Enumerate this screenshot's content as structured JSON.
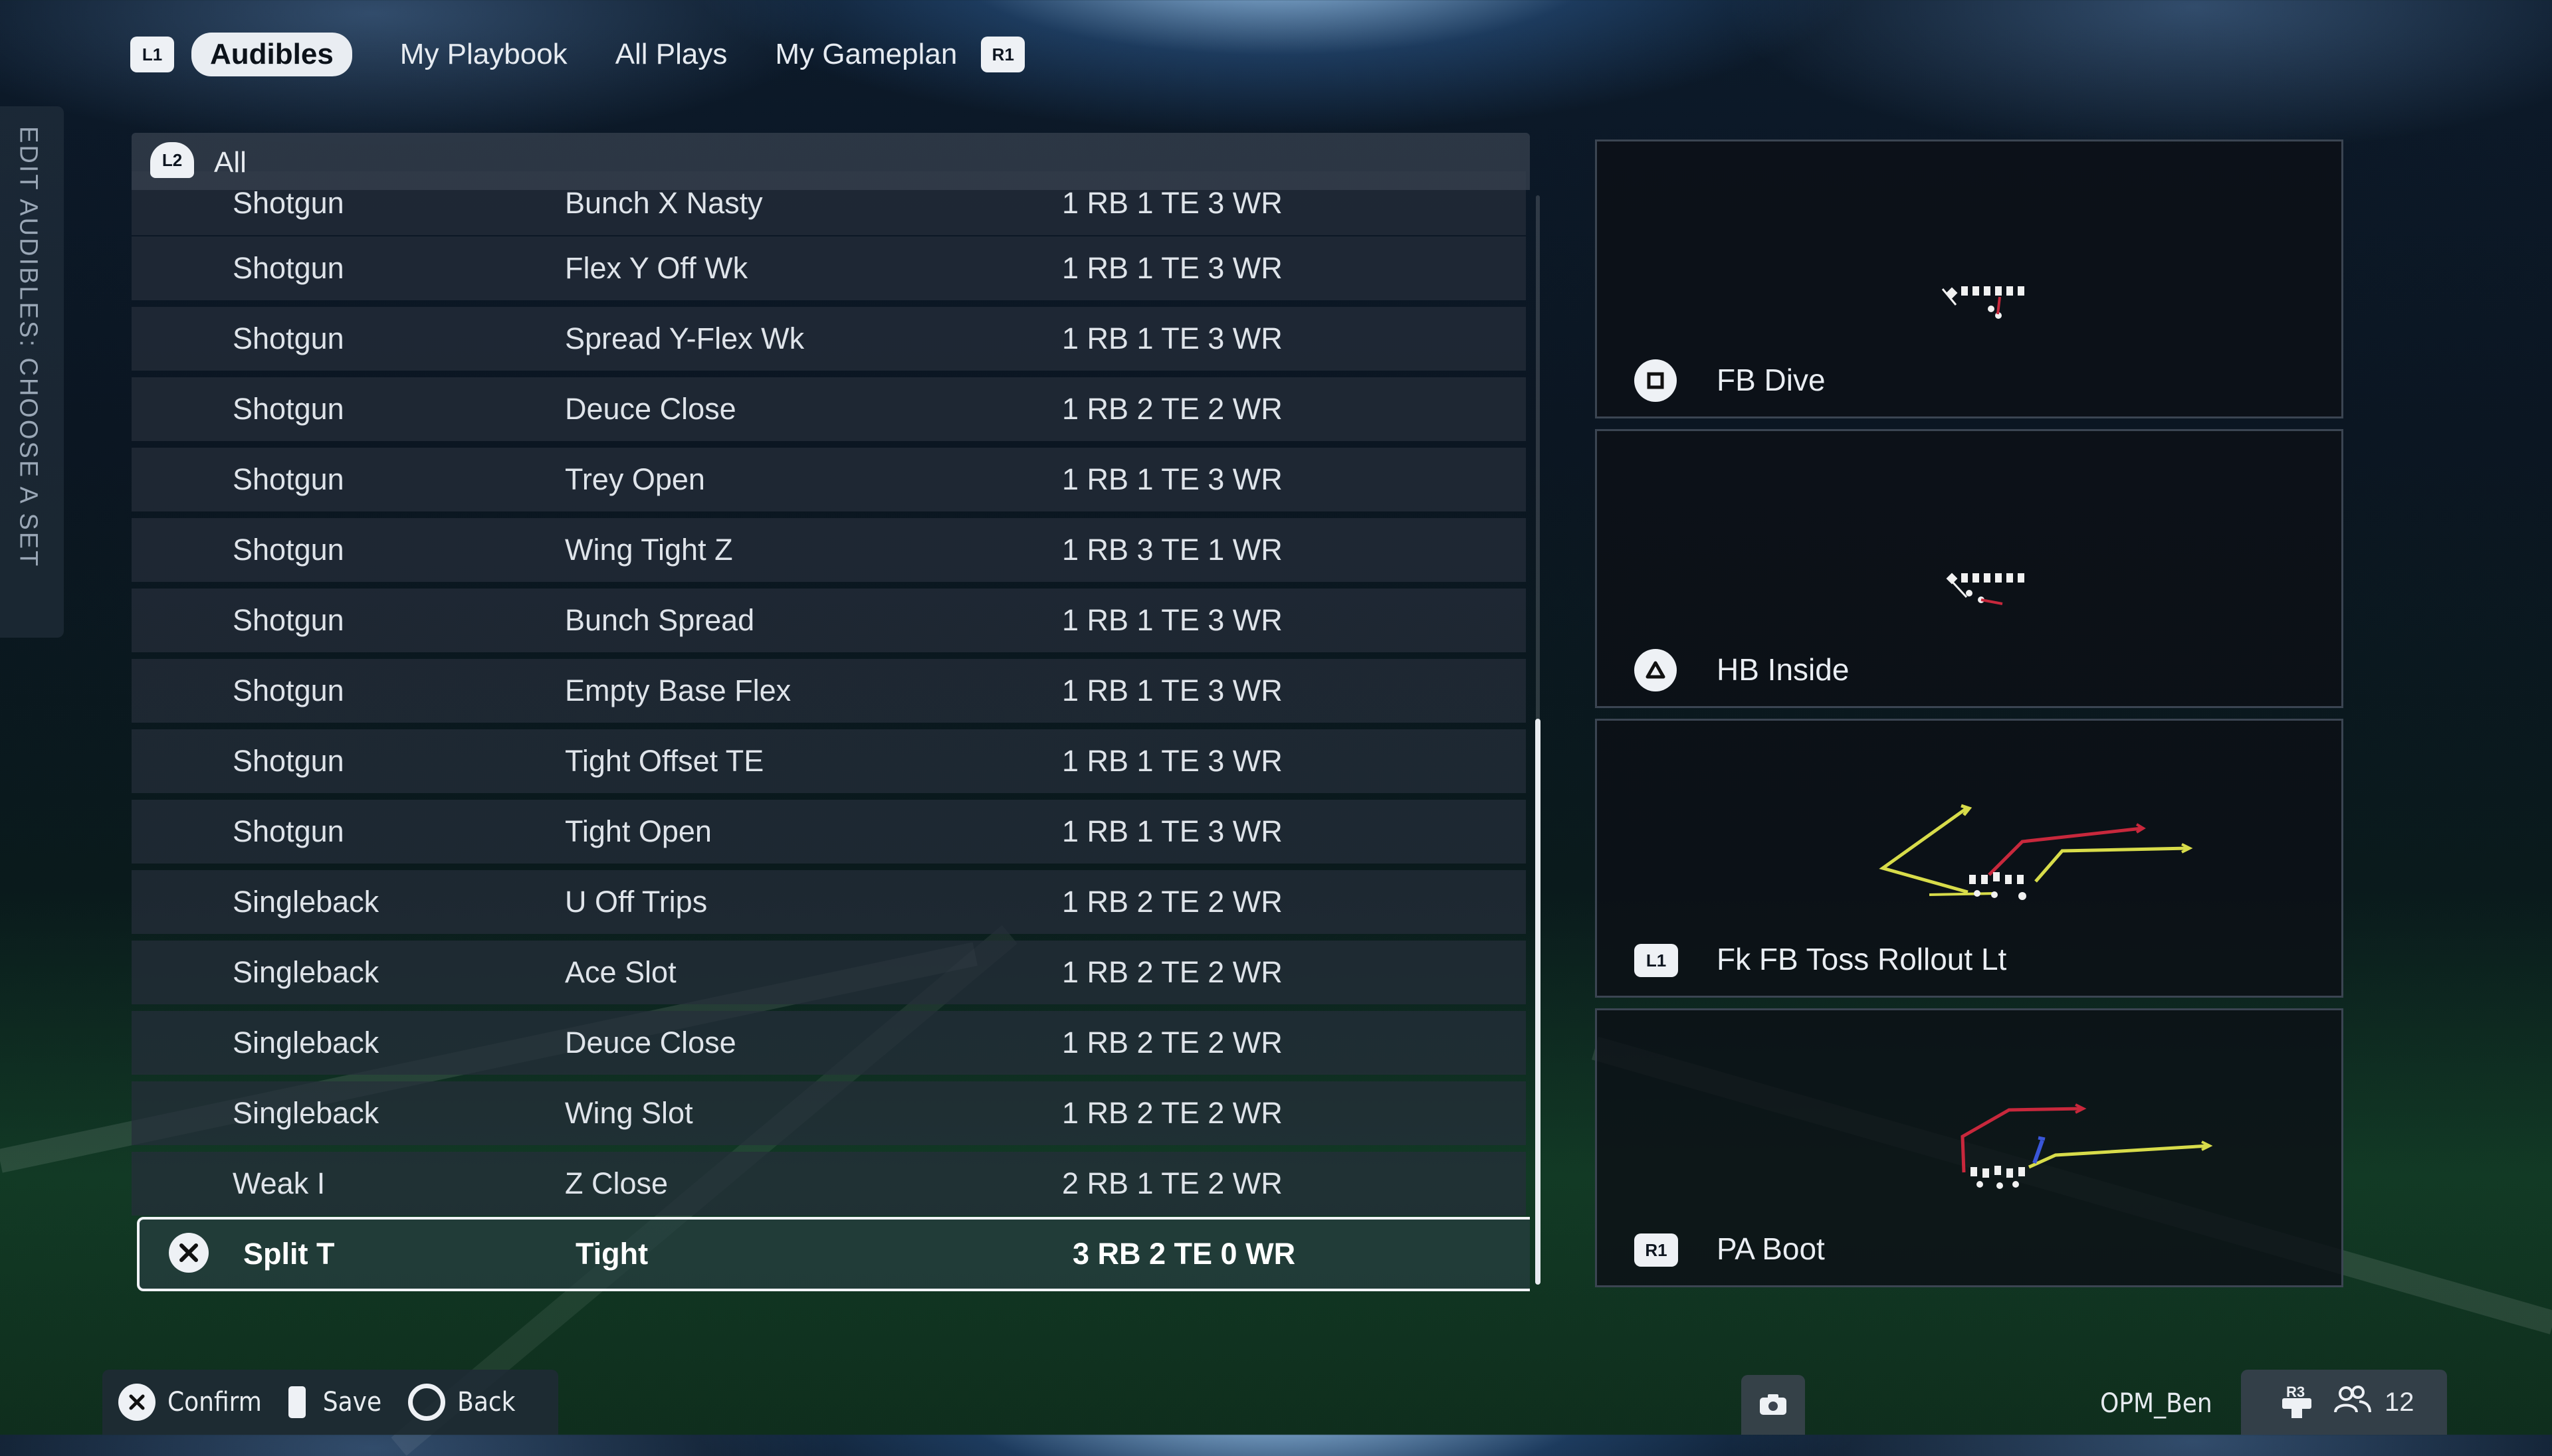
{
  "tabs": {
    "left_bumper": "L1",
    "right_bumper": "R1",
    "items": [
      {
        "label": "Audibles",
        "active": true
      },
      {
        "label": "My Playbook",
        "active": false
      },
      {
        "label": "All Plays",
        "active": false
      },
      {
        "label": "My Gameplan",
        "active": false
      }
    ]
  },
  "side_label": "EDIT AUDIBLES: CHOOSE A SET",
  "filter": {
    "button": "L2",
    "label": "All"
  },
  "rows": [
    {
      "formation": "Shotgun",
      "set": "Bunch X Nasty",
      "personnel": "1 RB 1 TE 3 WR"
    },
    {
      "formation": "Shotgun",
      "set": "Flex Y Off Wk",
      "personnel": "1 RB 1 TE 3 WR"
    },
    {
      "formation": "Shotgun",
      "set": "Spread Y-Flex Wk",
      "personnel": "1 RB 1 TE 3 WR"
    },
    {
      "formation": "Shotgun",
      "set": "Deuce Close",
      "personnel": "1 RB 2 TE 2 WR"
    },
    {
      "formation": "Shotgun",
      "set": "Trey Open",
      "personnel": "1 RB 1 TE 3 WR"
    },
    {
      "formation": "Shotgun",
      "set": "Wing Tight Z",
      "personnel": "1 RB 3 TE 1 WR"
    },
    {
      "formation": "Shotgun",
      "set": "Bunch Spread",
      "personnel": "1 RB 1 TE 3 WR"
    },
    {
      "formation": "Shotgun",
      "set": "Empty Base Flex",
      "personnel": "1 RB 1 TE 3 WR"
    },
    {
      "formation": "Shotgun",
      "set": "Tight Offset TE",
      "personnel": "1 RB 1 TE 3 WR"
    },
    {
      "formation": "Shotgun",
      "set": "Tight Open",
      "personnel": "1 RB 1 TE 3 WR"
    },
    {
      "formation": "Singleback",
      "set": "U Off Trips",
      "personnel": "1 RB 2 TE 2 WR"
    },
    {
      "formation": "Singleback",
      "set": "Ace Slot",
      "personnel": "1 RB 2 TE 2 WR"
    },
    {
      "formation": "Singleback",
      "set": "Deuce Close",
      "personnel": "1 RB 2 TE 2 WR"
    },
    {
      "formation": "Singleback",
      "set": "Wing Slot",
      "personnel": "1 RB 2 TE 2 WR"
    },
    {
      "formation": "Weak I",
      "set": "Z Close",
      "personnel": "2 RB 1 TE 2 WR"
    }
  ],
  "selected_row": {
    "formation": "Split T",
    "set": "Tight",
    "personnel": "3 RB 2 TE 0 WR",
    "button_icon": "cross-icon"
  },
  "audibles": [
    {
      "button_icon": "square-icon",
      "name": "FB Dive"
    },
    {
      "button_icon": "triangle-icon",
      "name": "HB Inside"
    },
    {
      "button_icon": "L1",
      "name": "Fk FB Toss Rollout Lt"
    },
    {
      "button_icon": "R1",
      "name": "PA Boot"
    }
  ],
  "footer": {
    "confirm": "Confirm",
    "save": "Save",
    "back": "Back",
    "username": "OPM_Ben",
    "party_button": "R3",
    "party_count": "12"
  },
  "colors": {
    "route_yellow": "#d8dc4a",
    "route_red": "#c8283c",
    "route_blue": "#3a56d8",
    "player_white": "#f1f1f1"
  }
}
